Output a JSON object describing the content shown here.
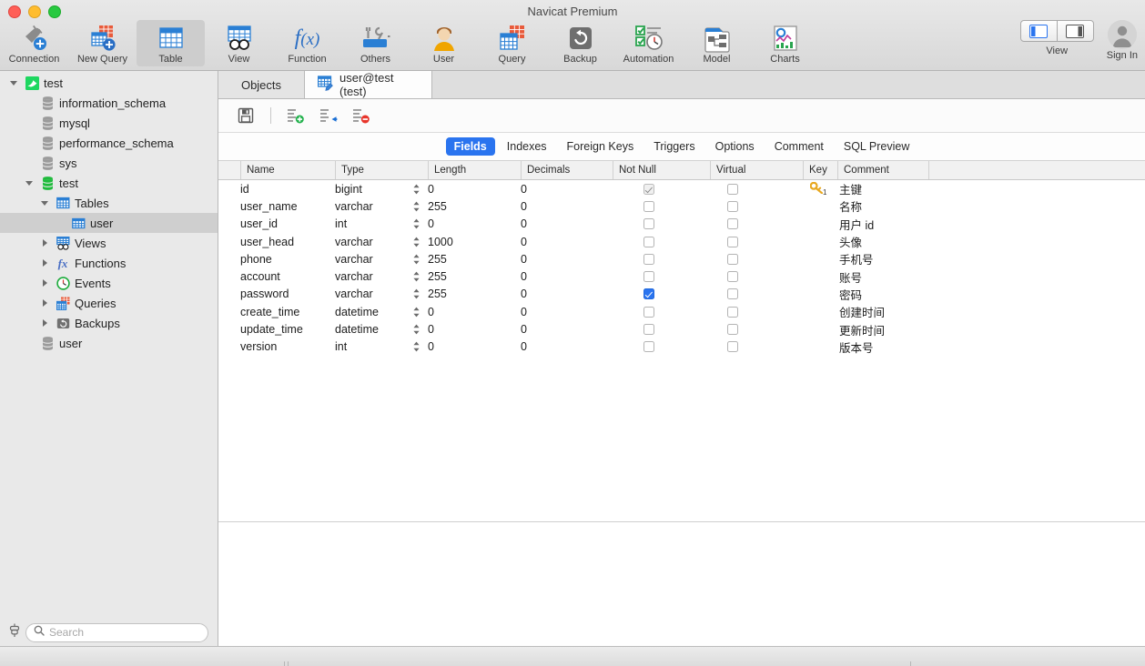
{
  "window": {
    "title": "Navicat Premium",
    "traffic_lights": [
      "close",
      "minimize",
      "zoom"
    ]
  },
  "toolbar": {
    "items": [
      {
        "label": "Connection",
        "icon": "connection-plug-add-icon",
        "selected": false
      },
      {
        "label": "New Query",
        "icon": "new-query-add-icon",
        "selected": false
      },
      {
        "label": "Table",
        "icon": "table-grid-icon",
        "selected": true
      },
      {
        "label": "View",
        "icon": "view-glasses-icon",
        "selected": false
      },
      {
        "label": "Function",
        "icon": "function-fx-icon",
        "selected": false
      },
      {
        "label": "Others",
        "icon": "others-tools-icon",
        "selected": false
      },
      {
        "label": "User",
        "icon": "user-person-icon",
        "selected": false
      },
      {
        "label": "Query",
        "icon": "query-tables-icon",
        "selected": false
      },
      {
        "label": "Backup",
        "icon": "backup-restore-icon",
        "selected": false
      },
      {
        "label": "Automation",
        "icon": "automation-clock-icon",
        "selected": false
      },
      {
        "label": "Model",
        "icon": "model-diagram-icon",
        "selected": false
      },
      {
        "label": "Charts",
        "icon": "charts-graph-icon",
        "selected": false
      }
    ],
    "right": {
      "view_label": "View",
      "view_buttons": [
        "sidebar-left-panel-icon",
        "sidebar-right-panel-icon"
      ],
      "view_selected_index": 0,
      "signin_label": "Sign In",
      "signin_icon": "avatar-person-icon"
    }
  },
  "sidebar": {
    "tree": [
      {
        "depth": 0,
        "twisty": "down",
        "icon": "mysql-dolphin-icon",
        "label": "test",
        "selected": false
      },
      {
        "depth": 1,
        "twisty": "none",
        "icon": "database-gray-icon",
        "label": "information_schema",
        "selected": false
      },
      {
        "depth": 1,
        "twisty": "none",
        "icon": "database-gray-icon",
        "label": "mysql",
        "selected": false
      },
      {
        "depth": 1,
        "twisty": "none",
        "icon": "database-gray-icon",
        "label": "performance_schema",
        "selected": false
      },
      {
        "depth": 1,
        "twisty": "none",
        "icon": "database-gray-icon",
        "label": "sys",
        "selected": false
      },
      {
        "depth": 1,
        "twisty": "down",
        "icon": "database-green-icon",
        "label": "test",
        "selected": false
      },
      {
        "depth": 2,
        "twisty": "down",
        "icon": "tables-folder-icon",
        "label": "Tables",
        "selected": false
      },
      {
        "depth": 3,
        "twisty": "none",
        "icon": "table-icon",
        "label": "user",
        "selected": true
      },
      {
        "depth": 2,
        "twisty": "right",
        "icon": "views-icon",
        "label": "Views",
        "selected": false
      },
      {
        "depth": 2,
        "twisty": "right",
        "icon": "functions-fx-icon",
        "label": "Functions",
        "selected": false
      },
      {
        "depth": 2,
        "twisty": "right",
        "icon": "events-clock-icon",
        "label": "Events",
        "selected": false
      },
      {
        "depth": 2,
        "twisty": "right",
        "icon": "queries-icon",
        "label": "Queries",
        "selected": false
      },
      {
        "depth": 2,
        "twisty": "right",
        "icon": "backups-icon",
        "label": "Backups",
        "selected": false
      },
      {
        "depth": 1,
        "twisty": "none",
        "icon": "database-gray-icon",
        "label": "user",
        "selected": false
      }
    ],
    "search": {
      "placeholder": "Search",
      "value": "",
      "icon": "search-magnifier-icon",
      "connection_icon": "connection-filter-icon"
    }
  },
  "main": {
    "tabs": [
      {
        "label": "Objects",
        "active": false,
        "icon": null
      },
      {
        "label": "user@test (test)",
        "active": true,
        "icon": "table-edit-icon"
      }
    ],
    "actions": [
      {
        "name": "save",
        "label": "Save",
        "icon": "floppy-save-icon"
      },
      {
        "name": "add-field",
        "label": "Add Field",
        "icon": "add-field-green-plus-icon"
      },
      {
        "name": "insert-field",
        "label": "Insert Field",
        "icon": "insert-field-blue-arrow-icon"
      },
      {
        "name": "delete-field",
        "label": "Delete Field",
        "icon": "delete-field-red-minus-icon"
      }
    ],
    "subtabs": [
      {
        "label": "Fields",
        "active": true
      },
      {
        "label": "Indexes",
        "active": false
      },
      {
        "label": "Foreign Keys",
        "active": false
      },
      {
        "label": "Triggers",
        "active": false
      },
      {
        "label": "Options",
        "active": false
      },
      {
        "label": "Comment",
        "active": false
      },
      {
        "label": "SQL Preview",
        "active": false
      }
    ],
    "grid": {
      "columns": [
        "Name",
        "Type",
        "Length",
        "Decimals",
        "Not Null",
        "Virtual",
        "Key",
        "Comment"
      ],
      "rows": [
        {
          "name": "id",
          "type": "bigint",
          "length": "0",
          "decimals": "0",
          "not_null": true,
          "not_null_dim": true,
          "virtual": false,
          "key": "primary-key-icon",
          "key_badge": "1",
          "comment": "主键"
        },
        {
          "name": "user_name",
          "type": "varchar",
          "length": "255",
          "decimals": "0",
          "not_null": false,
          "not_null_dim": false,
          "virtual": false,
          "key": null,
          "key_badge": "",
          "comment": "名称"
        },
        {
          "name": "user_id",
          "type": "int",
          "length": "0",
          "decimals": "0",
          "not_null": false,
          "not_null_dim": false,
          "virtual": false,
          "key": null,
          "key_badge": "",
          "comment": "用户 id"
        },
        {
          "name": "user_head",
          "type": "varchar",
          "length": "1000",
          "decimals": "0",
          "not_null": false,
          "not_null_dim": false,
          "virtual": false,
          "key": null,
          "key_badge": "",
          "comment": "头像"
        },
        {
          "name": "phone",
          "type": "varchar",
          "length": "255",
          "decimals": "0",
          "not_null": false,
          "not_null_dim": false,
          "virtual": false,
          "key": null,
          "key_badge": "",
          "comment": "手机号"
        },
        {
          "name": "account",
          "type": "varchar",
          "length": "255",
          "decimals": "0",
          "not_null": false,
          "not_null_dim": false,
          "virtual": false,
          "key": null,
          "key_badge": "",
          "comment": "账号"
        },
        {
          "name": "password",
          "type": "varchar",
          "length": "255",
          "decimals": "0",
          "not_null": true,
          "not_null_dim": false,
          "virtual": false,
          "key": null,
          "key_badge": "",
          "comment": "密码"
        },
        {
          "name": "create_time",
          "type": "datetime",
          "length": "0",
          "decimals": "0",
          "not_null": false,
          "not_null_dim": false,
          "virtual": false,
          "key": null,
          "key_badge": "",
          "comment": "创建时间"
        },
        {
          "name": "update_time",
          "type": "datetime",
          "length": "0",
          "decimals": "0",
          "not_null": false,
          "not_null_dim": false,
          "virtual": false,
          "key": null,
          "key_badge": "",
          "comment": "更新时间"
        },
        {
          "name": "version",
          "type": "int",
          "length": "0",
          "decimals": "0",
          "not_null": false,
          "not_null_dim": false,
          "virtual": false,
          "key": null,
          "key_badge": "",
          "comment": "版本号"
        }
      ]
    }
  },
  "colors": {
    "accent": "#2a74ef",
    "toolbar_bg": "#e0e0e0",
    "sidebar_bg": "#e9e9e9",
    "selection": "#cfcfcf",
    "key_gold": "#f0b323",
    "db_green": "#27ae38"
  }
}
